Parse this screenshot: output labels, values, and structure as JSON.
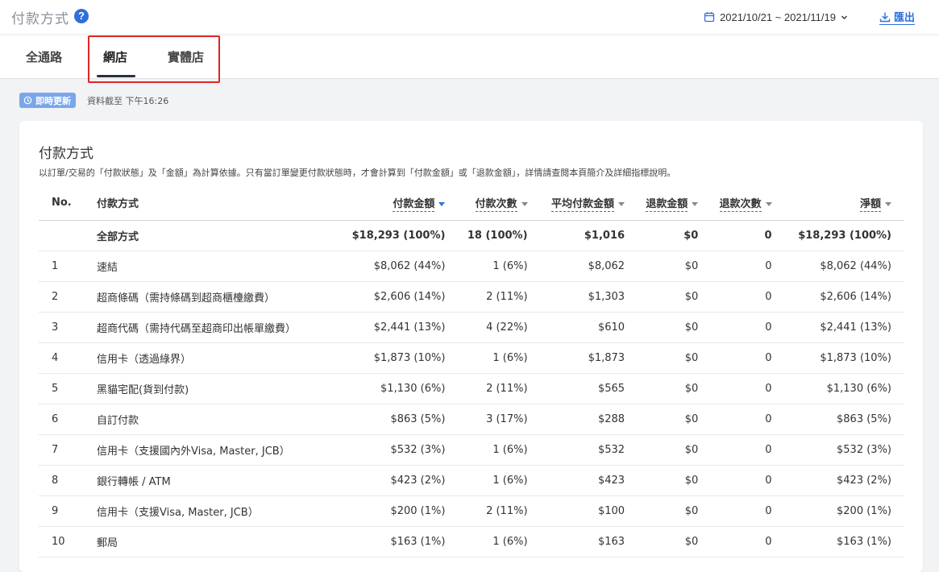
{
  "header": {
    "title": "付款方式",
    "help_icon": "question-circle-icon",
    "date_range": "2021/10/21 ~ 2021/11/19",
    "export_label": "匯出",
    "accent_color": "#2f6fdb"
  },
  "tabs": [
    {
      "label": "全通路",
      "active": false
    },
    {
      "label": "網店",
      "active": true
    },
    {
      "label": "實體店",
      "active": false
    }
  ],
  "status": {
    "realtime_label": "即時更新",
    "data_time": "資料截至 下午16:26"
  },
  "card": {
    "title": "付款方式",
    "description": "以訂單/交易的「付款狀態」及「金額」為計算依據。只有當訂單變更付款狀態時，才會計算到「付款金額」或「退款金額」，詳情請查閱本頁簡介及詳細指標說明。"
  },
  "table": {
    "columns": [
      "No.",
      "付款方式",
      "付款金額",
      "付款次數",
      "平均付款金額",
      "退款金額",
      "退款次數",
      "淨額"
    ],
    "total": [
      "",
      "全部方式",
      "$18,293 (100%)",
      "18 (100%)",
      "$1,016",
      "$0",
      "0",
      "$18,293 (100%)"
    ],
    "rows": [
      [
        "1",
        "速結",
        "$8,062 (44%)",
        "1 (6%)",
        "$8,062",
        "$0",
        "0",
        "$8,062 (44%)"
      ],
      [
        "2",
        "超商條碼（需持條碼到超商櫃檯繳費）",
        "$2,606 (14%)",
        "2 (11%)",
        "$1,303",
        "$0",
        "0",
        "$2,606 (14%)"
      ],
      [
        "3",
        "超商代碼（需持代碼至超商印出帳單繳費）",
        "$2,441 (13%)",
        "4 (22%)",
        "$610",
        "$0",
        "0",
        "$2,441 (13%)"
      ],
      [
        "4",
        "信用卡（透過綠界）",
        "$1,873 (10%)",
        "1 (6%)",
        "$1,873",
        "$0",
        "0",
        "$1,873 (10%)"
      ],
      [
        "5",
        "黑貓宅配(貨到付款)",
        "$1,130 (6%)",
        "2 (11%)",
        "$565",
        "$0",
        "0",
        "$1,130 (6%)"
      ],
      [
        "6",
        "自訂付款",
        "$863 (5%)",
        "3 (17%)",
        "$288",
        "$0",
        "0",
        "$863 (5%)"
      ],
      [
        "7",
        "信用卡（支援國內外Visa, Master, JCB）",
        "$532 (3%)",
        "1 (6%)",
        "$532",
        "$0",
        "0",
        "$532 (3%)"
      ],
      [
        "8",
        "銀行轉帳 / ATM",
        "$423 (2%)",
        "1 (6%)",
        "$423",
        "$0",
        "0",
        "$423 (2%)"
      ],
      [
        "9",
        "信用卡（支援Visa, Master, JCB）",
        "$200 (1%)",
        "2 (11%)",
        "$100",
        "$0",
        "0",
        "$200 (1%)"
      ],
      [
        "10",
        "郵局",
        "$163 (1%)",
        "1 (6%)",
        "$163",
        "$0",
        "0",
        "$163 (1%)"
      ]
    ]
  }
}
